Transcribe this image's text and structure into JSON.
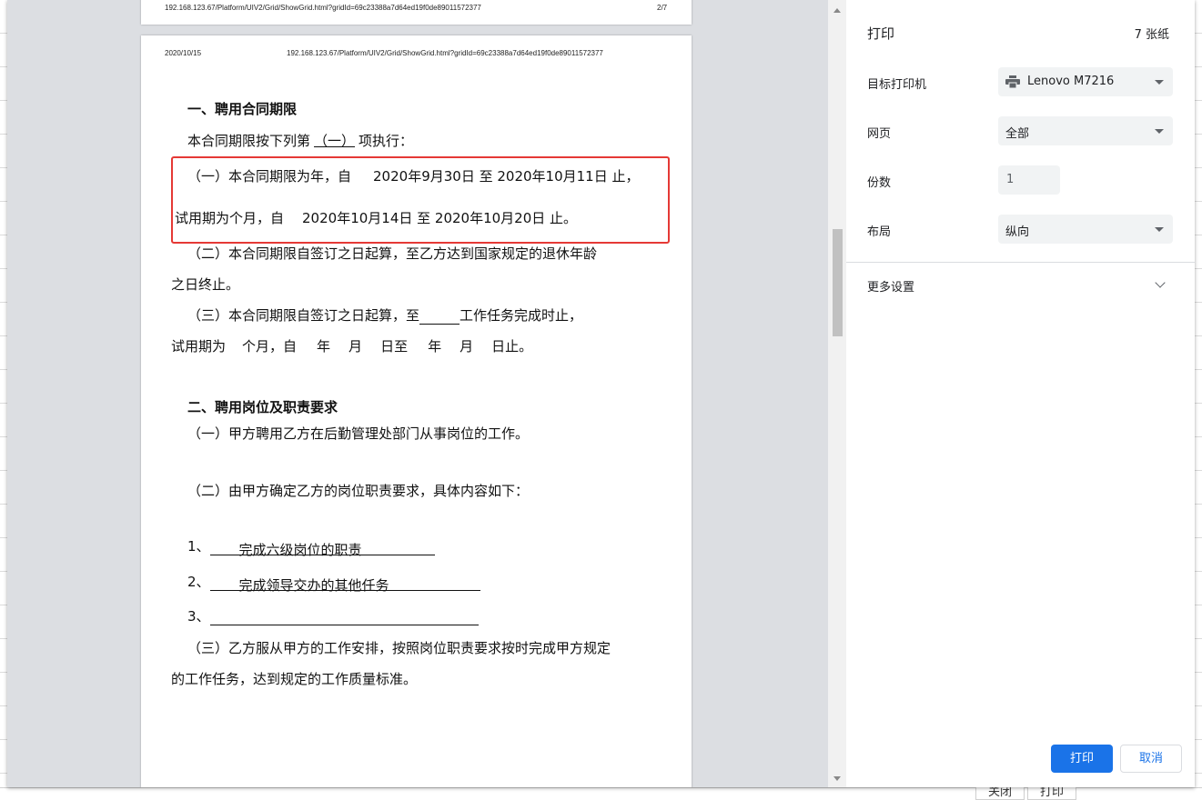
{
  "preview": {
    "prev_page": {
      "url": "192.168.123.67/Platform/UIV2/Grid/ShowGrid.html?gridId=69c23388a7d64ed19f0de89011572377",
      "page_num": "2/7"
    },
    "header": {
      "date": "2020/10/15",
      "url": "192.168.123.67/Platform/UIV2/Grid/ShowGrid.html?gridId=69c23388a7d64ed19f0de89011572377"
    },
    "doc": {
      "s1_title": "一、聘用合同期限",
      "s1_intro_a": "本合同期限按下列第",
      "s1_intro_choice": "（一）",
      "s1_intro_b": "项执行：",
      "s1_i1_a": "（一）本合同期限为年，自",
      "s1_i1_b": "2020年9月30日 至 2020年10月11日 止，",
      "s1_i1_c": "试用期为个月，自",
      "s1_i1_d": "2020年10月14日 至 2020年10月20日 止。",
      "s1_i2_a": "（二）本合同期限自签订之日起算，至乙方达到国家规定的退休年龄",
      "s1_i2_b": "之日终止。",
      "s1_i3_a": "（三）本合同期限自签订之日起算，至",
      "s1_i3_b": "工作任务完成时止，",
      "s1_i3_c": "试用期为",
      "s1_i3_d": "个月，自",
      "s1_i3_e": "年",
      "s1_i3_f": "月",
      "s1_i3_g": "日至",
      "s1_i3_h": "年",
      "s1_i3_i": "月",
      "s1_i3_j": "日止。",
      "s2_title": "二、聘用岗位及职责要求",
      "s2_p1": "（一）甲方聘用乙方在后勤管理处部门从事岗位的工作。",
      "s2_p2": "（二）由甲方确定乙方的岗位职责要求，具体内容如下：",
      "s2_l1_num": "1、",
      "s2_l1_text": "完成六级岗位的职责",
      "s2_l2_num": "2、",
      "s2_l2_text": "完成领导交办的其他任务",
      "s2_l3_num": "3、",
      "s2_p3_a": "（三）乙方服从甲方的工作安排，按照岗位职责要求按时完成甲方规定",
      "s2_p3_b": "的工作任务，达到规定的工作质量标准。"
    }
  },
  "settings": {
    "title": "打印",
    "sheet_count": "7 张纸",
    "destination_label": "目标打印机",
    "destination_value": "Lenovo M7216",
    "destination_icon": "printer-icon",
    "pages_label": "网页",
    "pages_value": "全部",
    "copies_label": "份数",
    "copies_value": "1",
    "layout_label": "布局",
    "layout_value": "纵向",
    "more_settings_label": "更多设置",
    "print_button": "打印",
    "cancel_button": "取消",
    "accent_color": "#1a73e8"
  },
  "background": {
    "close_button": "关闭",
    "print_button": "打印"
  }
}
